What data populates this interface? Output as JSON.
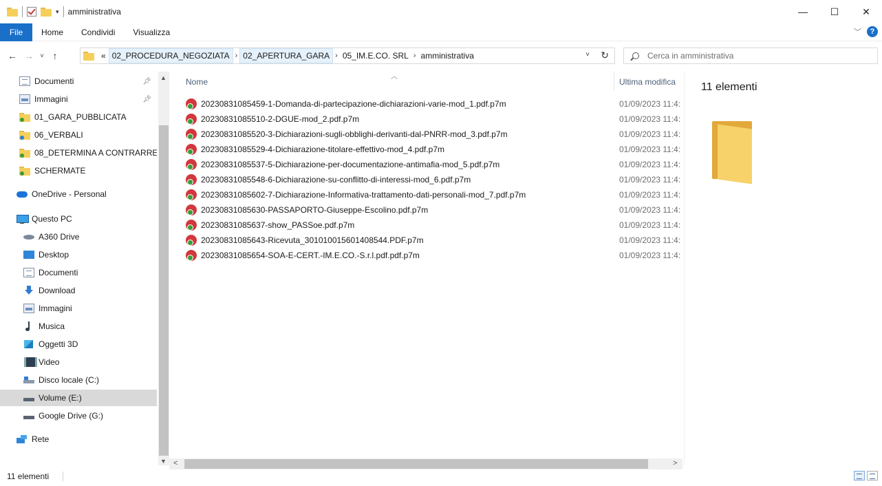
{
  "window": {
    "title": "amministrativa",
    "minimize": "—",
    "maximize": "☐",
    "close": "✕"
  },
  "ribbon": {
    "tabs": [
      "File",
      "Home",
      "Condividi",
      "Visualizza"
    ],
    "help": "?"
  },
  "address": {
    "prefix": "«",
    "crumbs": [
      "02_PROCEDURA_NEGOZIATA",
      "02_APERTURA_GARA",
      "05_IM.E.CO. SRL",
      "amministrativa"
    ]
  },
  "search": {
    "placeholder": "Cerca in amministrativa"
  },
  "nav": {
    "items": [
      {
        "label": "Documenti",
        "icon": "document-icon",
        "pinned": true
      },
      {
        "label": "Immagini",
        "icon": "pictures-icon",
        "pinned": true
      },
      {
        "label": "01_GARA_PUBBLICATA",
        "icon": "folder-sync-icon"
      },
      {
        "label": "06_VERBALI",
        "icon": "folder-sync-icon"
      },
      {
        "label": "08_DETERMINA A CONTRARRE",
        "icon": "folder-sync-icon"
      },
      {
        "label": "SCHERMATE",
        "icon": "folder-sync-icon"
      },
      {
        "label": "OneDrive - Personal",
        "icon": "onedrive-icon"
      },
      {
        "label": "Questo PC",
        "icon": "computer-icon"
      },
      {
        "label": "A360 Drive",
        "icon": "a360-drive-icon"
      },
      {
        "label": "Desktop",
        "icon": "desktop-icon"
      },
      {
        "label": "Documenti",
        "icon": "document-icon"
      },
      {
        "label": "Download",
        "icon": "download-icon"
      },
      {
        "label": "Immagini",
        "icon": "pictures-icon"
      },
      {
        "label": "Musica",
        "icon": "music-icon"
      },
      {
        "label": "Oggetti 3D",
        "icon": "3d-objects-icon"
      },
      {
        "label": "Video",
        "icon": "video-icon"
      },
      {
        "label": "Disco locale (C:)",
        "icon": "local-disk-icon"
      },
      {
        "label": "Volume (E:)",
        "icon": "drive-icon",
        "selected": true
      },
      {
        "label": "Google Drive (G:)",
        "icon": "drive-icon"
      },
      {
        "label": "Rete",
        "icon": "network-icon"
      }
    ]
  },
  "columns": {
    "name": "Nome",
    "modified": "Ultima modifica"
  },
  "files": [
    {
      "name": "20230831085459-1-Domanda-di-partecipazione-dichiarazioni-varie-mod_1.pdf.p7m",
      "date": "01/09/2023 11:4:"
    },
    {
      "name": "20230831085510-2-DGUE-mod_2.pdf.p7m",
      "date": "01/09/2023 11:4:"
    },
    {
      "name": "20230831085520-3-Dichiarazioni-sugli-obblighi-derivanti-dal-PNRR-mod_3.pdf.p7m",
      "date": "01/09/2023 11:4:"
    },
    {
      "name": "20230831085529-4-Dichiarazione-titolare-effettivo-mod_4.pdf.p7m",
      "date": "01/09/2023 11:4:"
    },
    {
      "name": "20230831085537-5-Dichiarazione-per-documentazione-antimafia-mod_5.pdf.p7m",
      "date": "01/09/2023 11:4:"
    },
    {
      "name": "20230831085548-6-Dichiarazione-su-conflitto-di-interessi-mod_6.pdf.p7m",
      "date": "01/09/2023 11:4:"
    },
    {
      "name": "20230831085602-7-Dichiarazione-Informativa-trattamento-dati-personali-mod_7.pdf.p7m",
      "date": "01/09/2023 11:4:"
    },
    {
      "name": "20230831085630-PASSAPORTO-Giuseppe-Escolino.pdf.p7m",
      "date": "01/09/2023 11:4:"
    },
    {
      "name": "20230831085637-show_PASSoe.pdf.p7m",
      "date": "01/09/2023 11:4:"
    },
    {
      "name": "20230831085643-Ricevuta_301010015601408544.PDF.p7m",
      "date": "01/09/2023 11:4:"
    },
    {
      "name": "20230831085654-SOA-E-CERT.-IM.E.CO.-S.r.l.pdf.pdf.p7m",
      "date": "01/09/2023 11:4:"
    }
  ],
  "preview": {
    "count": "11 elementi"
  },
  "status": {
    "count": "11 elementi"
  }
}
